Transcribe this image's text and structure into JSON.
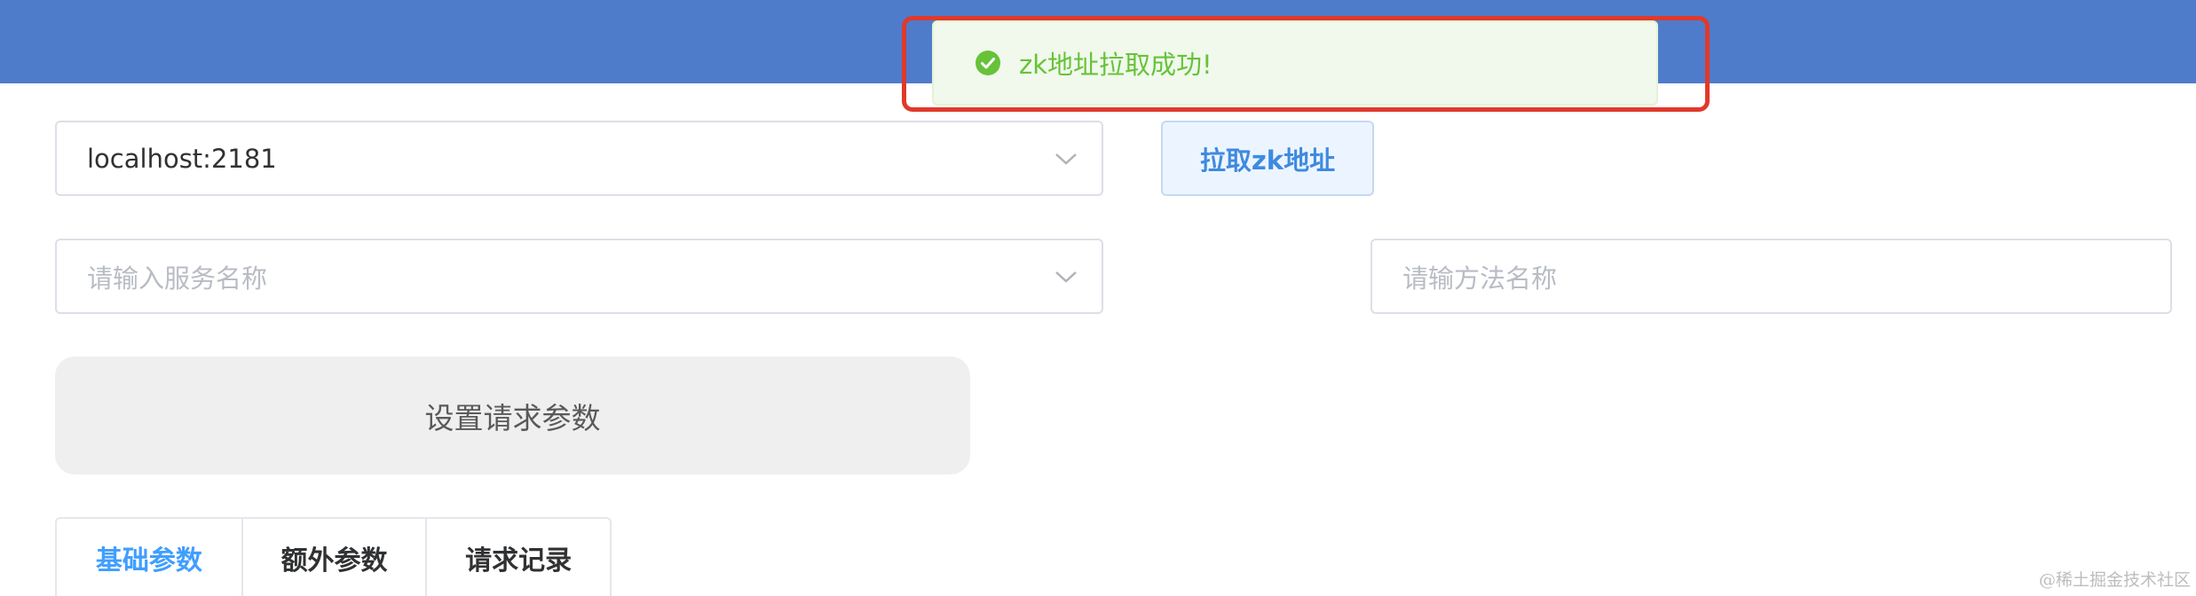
{
  "zk": {
    "selected": "localhost:2181",
    "pull_button": "拉取zk地址"
  },
  "service": {
    "placeholder": "请输入服务名称"
  },
  "method": {
    "placeholder": "请输方法名称"
  },
  "params_button": "设置请求参数",
  "tabs": [
    {
      "label": "基础参数",
      "active": true
    },
    {
      "label": "额外参数",
      "active": false
    },
    {
      "label": "请求记录",
      "active": false
    }
  ],
  "toast": {
    "message": "zk地址拉取成功!",
    "icon": "check-circle-icon"
  },
  "watermark": "@稀土掘金技术社区",
  "colors": {
    "header": "#4f7bcb",
    "primary": "#409eff",
    "success": "#67c23a",
    "highlight": "#e0392b"
  }
}
